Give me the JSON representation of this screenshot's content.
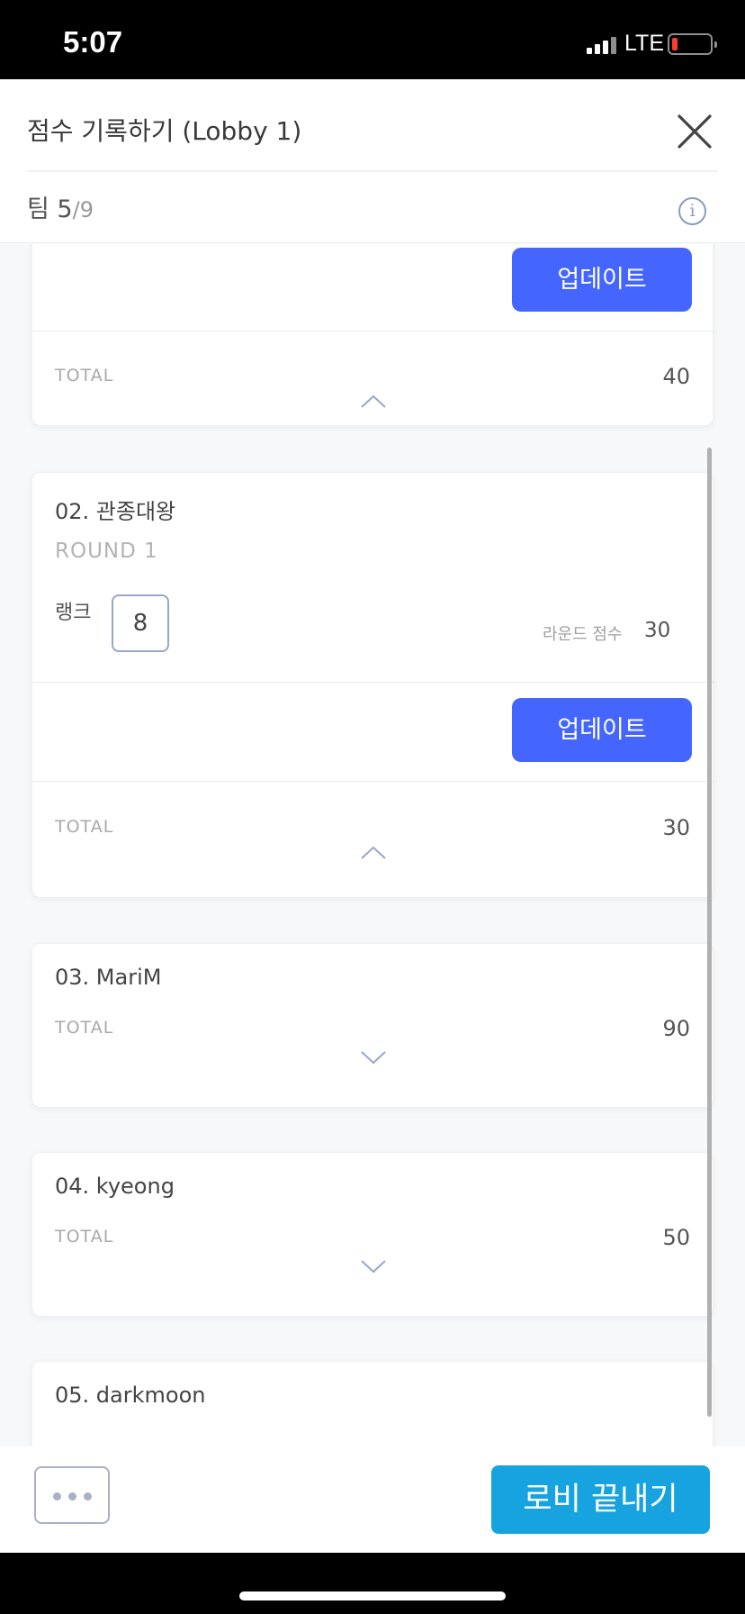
{
  "status_bar": {
    "time": "5:07",
    "network": "LTE"
  },
  "header": {
    "title": "점수 기록하기 (Lobby 1)",
    "team_label": "팀 5",
    "team_total": "/9",
    "info_glyph": "i"
  },
  "team_cards": [
    {
      "update_label": "업데이트",
      "total_label": "TOTAL",
      "total_value": "40",
      "expanded": true
    },
    {
      "name": "02. 관종대왕",
      "round_label": "ROUND 1",
      "rank_label": "랭크",
      "rank_value": "8",
      "round_score_label": "라운드 점수",
      "round_score_value": "30",
      "update_label": "업데이트",
      "total_label": "TOTAL",
      "total_value": "30",
      "expanded": true
    },
    {
      "name": "03. MariM",
      "total_label": "TOTAL",
      "total_value": "90",
      "expanded": false
    },
    {
      "name": "04. kyeong",
      "total_label": "TOTAL",
      "total_value": "50",
      "expanded": false
    },
    {
      "name": "05. darkmoon"
    }
  ],
  "bottom_bar": {
    "end_lobby_label": "로비 끝내기"
  },
  "icons": {
    "close": "close-icon",
    "info": "info-icon",
    "expanded": "chevron-up-icon",
    "collapsed": "chevron-down-icon",
    "more": "more-icon"
  },
  "colors": {
    "primary_button": "#4466ff",
    "end_lobby_button": "#17a3e0",
    "battery_low": "#ff3b30"
  }
}
